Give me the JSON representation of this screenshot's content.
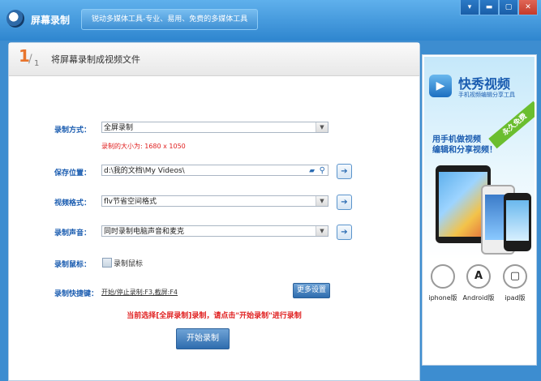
{
  "app": {
    "title": "屏幕录制",
    "slogan": "锐动多媒体工具-专业、易用、免费的多媒体工具"
  },
  "window_controls": {
    "menu": "▾",
    "min": "▬",
    "max": "▢",
    "close": "✕"
  },
  "step": {
    "num": "1",
    "slash": "/",
    "den": "1",
    "title": "将屏幕录制成视频文件"
  },
  "form": {
    "mode": {
      "label": "录制方式：",
      "value": "全屏录制",
      "size_note": "录制的大小为: 1680 x 1050"
    },
    "save": {
      "label": "保存位置：",
      "value": "d:\\我的文档\\My Videos\\"
    },
    "format": {
      "label": "视频格式：",
      "value": "flv节省空间格式"
    },
    "audio": {
      "label": "录制声音：",
      "value": "同时录制电脑声音和麦克"
    },
    "mouse": {
      "label": "录制鼠标：",
      "checkbox_label": "录制鼠标"
    },
    "hotkey": {
      "label": "录制快捷键：",
      "value": "开始/停止录制:F3,截屏:F4",
      "more_btn": "更多设置"
    },
    "warning": "当前选择[全屏录制]录制，请点击\"开始录制\"进行录制",
    "start_btn": "开始录制"
  },
  "ad": {
    "brand": "快秀视频",
    "sub": "手机视频编辑分享工具",
    "ribbon": "永久免费",
    "slogan_line1": "用手机做视频",
    "slogan_line2": "编辑和分享视频！",
    "platforms": [
      {
        "label": "iphone版",
        "glyph": ""
      },
      {
        "label": "Android版",
        "glyph": "A"
      },
      {
        "label": "ipad版",
        "glyph": "▢"
      }
    ]
  },
  "icons": {
    "folder": "folder-icon",
    "search": "search-icon",
    "go": "arrow-right-icon"
  }
}
